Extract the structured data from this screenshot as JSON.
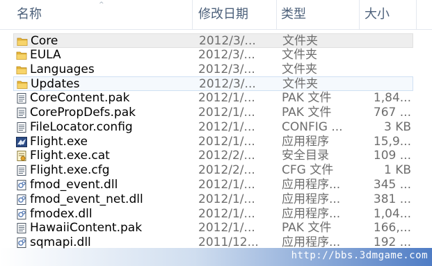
{
  "header": {
    "col_name": "名称",
    "col_date": "修改日期",
    "col_type": "类型",
    "col_size": "大小"
  },
  "files": [
    {
      "name": "Core",
      "date": "2012/3/...",
      "type": "文件夹",
      "size": "",
      "icon": "folder-icon"
    },
    {
      "name": "EULA",
      "date": "2012/3/...",
      "type": "文件夹",
      "size": "",
      "icon": "folder-icon"
    },
    {
      "name": "Languages",
      "date": "2012/3/...",
      "type": "文件夹",
      "size": "",
      "icon": "folder-icon"
    },
    {
      "name": "Updates",
      "date": "2012/3/...",
      "type": "文件夹",
      "size": "",
      "icon": "folder-icon"
    },
    {
      "name": "CoreContent.pak",
      "date": "2012/1/...",
      "type": "PAK 文件",
      "size": "1,84...",
      "icon": "file-icon"
    },
    {
      "name": "CorePropDefs.pak",
      "date": "2012/1/...",
      "type": "PAK 文件",
      "size": "767 ...",
      "icon": "file-icon"
    },
    {
      "name": "FileLocator.config",
      "date": "2012/1/...",
      "type": "CONFIG ...",
      "size": "3 KB",
      "icon": "file-icon"
    },
    {
      "name": "Flight.exe",
      "date": "2012/1/...",
      "type": "应用程序",
      "size": "15,9...",
      "icon": "app-icon"
    },
    {
      "name": "Flight.exe.cat",
      "date": "2012/2/...",
      "type": "安全目录",
      "size": "109 ...",
      "icon": "catalog-icon"
    },
    {
      "name": "Flight.exe.cfg",
      "date": "2012/2/...",
      "type": "CFG 文件",
      "size": "1 KB",
      "icon": "file-icon"
    },
    {
      "name": "fmod_event.dll",
      "date": "2012/1/...",
      "type": "应用程序...",
      "size": "345 ...",
      "icon": "dll-icon"
    },
    {
      "name": "fmod_event_net.dll",
      "date": "2012/1/...",
      "type": "应用程序...",
      "size": "381 ...",
      "icon": "dll-icon"
    },
    {
      "name": "fmodex.dll",
      "date": "2012/1/...",
      "type": "应用程序...",
      "size": "1,04...",
      "icon": "dll-icon"
    },
    {
      "name": "HawaiiContent.pak",
      "date": "2012/1/...",
      "type": "PAK 文件",
      "size": "166,...",
      "icon": "file-icon"
    },
    {
      "name": "sqmapi.dll",
      "date": "2011/12...",
      "type": "应用程序...",
      "size": "192 ...",
      "icon": "dll-icon"
    }
  ],
  "watermark": "http://bbs.3dmgame.com"
}
